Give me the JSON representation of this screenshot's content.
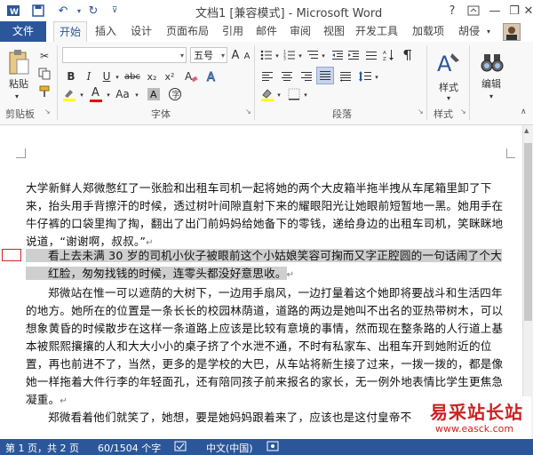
{
  "window": {
    "title": "文档1 [兼容模式] - Microsoft Word",
    "help": "?",
    "minimize": "—",
    "restore": "❐",
    "close": "✕"
  },
  "tabs": {
    "file": "文件",
    "items": [
      "开始",
      "插入",
      "设计",
      "页面布局",
      "引用",
      "邮件",
      "审阅",
      "视图",
      "开发工具",
      "加载项"
    ],
    "user": "胡侵"
  },
  "ribbon": {
    "paste": "粘贴",
    "font_name": "",
    "font_size": "五号",
    "font_size_a1": "A",
    "font_size_a2": "A",
    "aa": "Aa",
    "font_color_a": "A",
    "bold": "B",
    "italic": "I",
    "underline": "U",
    "strike": "abc",
    "subscript": "x₂",
    "superscript": "x²",
    "style_label": "样式",
    "edit_label": "编辑",
    "groups": {
      "clipboard": "剪贴板",
      "font": "字体",
      "paragraph": "段落",
      "style": "样式"
    }
  },
  "document": {
    "p1": "大学新鲜人郑微憋红了一张脸和出租车司机一起将她的两个大皮箱半拖半拽从车尾箱里卸了下来，抬头用手背擦汗的时候，透过树叶间隙直射下来的耀眼阳光让她眼前短暂地一黑。她用手在牛仔裤的口袋里掏了掏，翻出了出门前妈妈给她备下的零钱，递给身边的出租车司机，笑眯眯地说道，“谢谢啊，叔叔。”",
    "p2": "看上去未满 30 岁的司机小伙子被眼前这个小姑娘笑容可掬而又字正腔圆的一句话闹了个大红脸，匆匆找钱的时候，连零头都没好意思收。",
    "p3": "郑微站在惟一可以遮荫的大树下，一边用手扇风，一边打量着这个她即将要战斗和生活四年的地方。她所在的位置是一条长长的校园林荫道，道路的两边是她叫不出名的亚热带树木，可以想象黄昏的时候散步在这样一条道路上应该是比较有意境的事情，然而现在整条路的人行道上基本被熙熙攘攘的人和大大小小的桌子挤了个水泄不通，不时有私家车、出租车开到她附近的位置，再也前进不了，当然，更多的是学校的大巴，从车站将新生接了过来，一拨一拨的，都是像她一样拖着大件行李的年轻面孔，还有陪同孩子前来报名的家长，无一例外地表情比学生更焦急凝重。",
    "p4": "郑微看着他们就笑了，她想，要是她妈妈跟着来了，应该也是这付皇帝不"
  },
  "statusbar": {
    "page": "第 1 页，共 2 页",
    "words": "60/1504 个字",
    "lang": "中文(中国)"
  },
  "watermark": {
    "brand": "易采站长站",
    "url": "www.easck.com"
  },
  "colors": {
    "accent": "#2b579a",
    "highlight": "#cfcfcf",
    "watermark_red": "#cc2222"
  }
}
